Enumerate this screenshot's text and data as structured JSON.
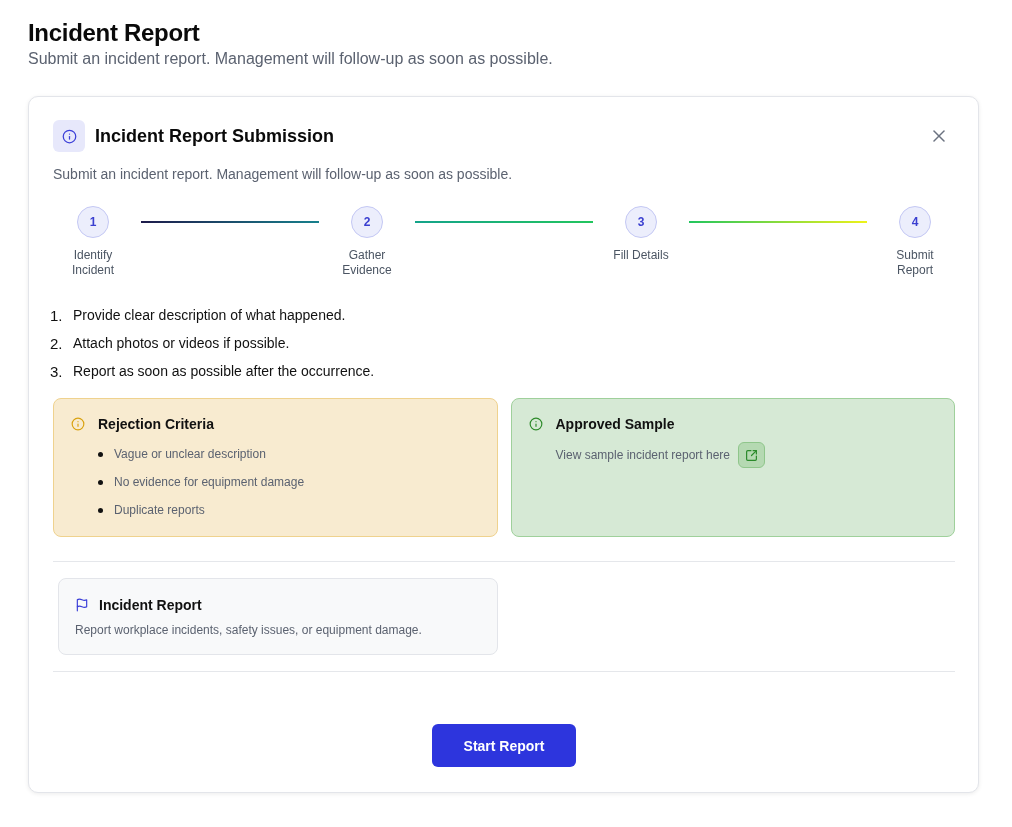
{
  "page": {
    "title": "Incident Report",
    "subtitle": "Submit an incident report. Management will follow-up as soon as possible."
  },
  "dialog": {
    "title": "Incident Report Submission",
    "description": "Submit an incident report. Management will follow-up as soon as possible.",
    "steps": [
      {
        "number": "1",
        "label": "Identify Incident"
      },
      {
        "number": "2",
        "label": "Gather Evidence"
      },
      {
        "number": "3",
        "label": "Fill Details"
      },
      {
        "number": "4",
        "label": "Submit Report"
      }
    ],
    "instructions": [
      {
        "number": "1.",
        "text": "Provide clear description of what happened."
      },
      {
        "number": "2.",
        "text": "Attach photos or videos if possible."
      },
      {
        "number": "3.",
        "text": "Report as soon as possible after the occurrence."
      }
    ],
    "notices": [
      {
        "kind": "warning",
        "title": "Rejection Criteria",
        "items": [
          "Vague or unclear description",
          "No evidence for equipment damage",
          "Duplicate reports"
        ]
      },
      {
        "kind": "success",
        "title": "Approved Sample",
        "text": "View sample incident report here"
      }
    ],
    "report_types": [
      {
        "title": "Incident Report",
        "description": "Report workplace incidents, safety issues, or equipment damage."
      }
    ],
    "primary_button": "Start Report"
  }
}
